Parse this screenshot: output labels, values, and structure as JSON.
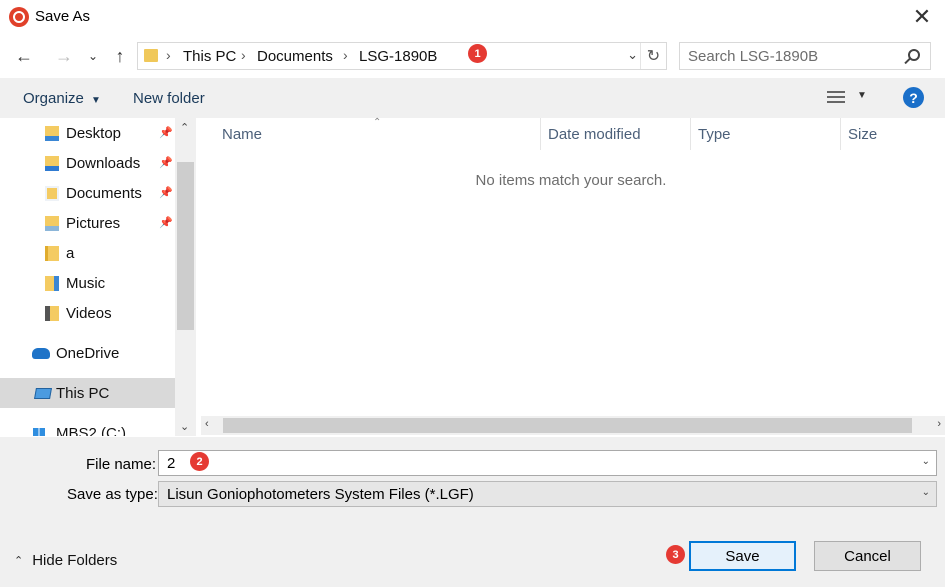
{
  "window": {
    "title": "Save As"
  },
  "nav": {
    "breadcrumbs": [
      "This PC",
      "Documents",
      "LSG-1890B"
    ],
    "search_placeholder": "Search LSG-1890B"
  },
  "toolbar": {
    "organize_label": "Organize",
    "new_folder_label": "New folder",
    "help_label": "?"
  },
  "sidebar": {
    "items": [
      {
        "label": "Desktop",
        "icon": "desktop-folder-icon",
        "pinned": true
      },
      {
        "label": "Downloads",
        "icon": "downloads-folder-icon",
        "pinned": true
      },
      {
        "label": "Documents",
        "icon": "documents-folder-icon",
        "pinned": true
      },
      {
        "label": "Pictures",
        "icon": "pictures-folder-icon",
        "pinned": true
      },
      {
        "label": "a",
        "icon": "folder-icon",
        "pinned": false
      },
      {
        "label": "Music",
        "icon": "music-folder-icon",
        "pinned": false
      },
      {
        "label": "Videos",
        "icon": "videos-folder-icon",
        "pinned": false
      },
      {
        "label": "OneDrive",
        "icon": "onedrive-cloud-icon",
        "pinned": false
      },
      {
        "label": "This PC",
        "icon": "this-pc-icon",
        "pinned": false,
        "selected": true
      },
      {
        "label": "MBS2 (C:)",
        "icon": "windows-drive-icon",
        "pinned": false
      }
    ]
  },
  "file_list": {
    "columns": [
      "Name",
      "Date modified",
      "Type",
      "Size"
    ],
    "empty_message": "No items match your search."
  },
  "form": {
    "file_name_label": "File name:",
    "file_name_value": "2",
    "save_type_label": "Save as type:",
    "save_type_value": "Lisun Goniophotometers System Files (*.LGF)"
  },
  "footer": {
    "hide_folders_label": "Hide Folders",
    "save_label": "Save",
    "cancel_label": "Cancel"
  },
  "annotations": {
    "step1": "1",
    "step2": "2",
    "step3": "3"
  },
  "colors": {
    "accent": "#0078d7",
    "badge": "#e53a33",
    "folder": "#f4cb62"
  }
}
